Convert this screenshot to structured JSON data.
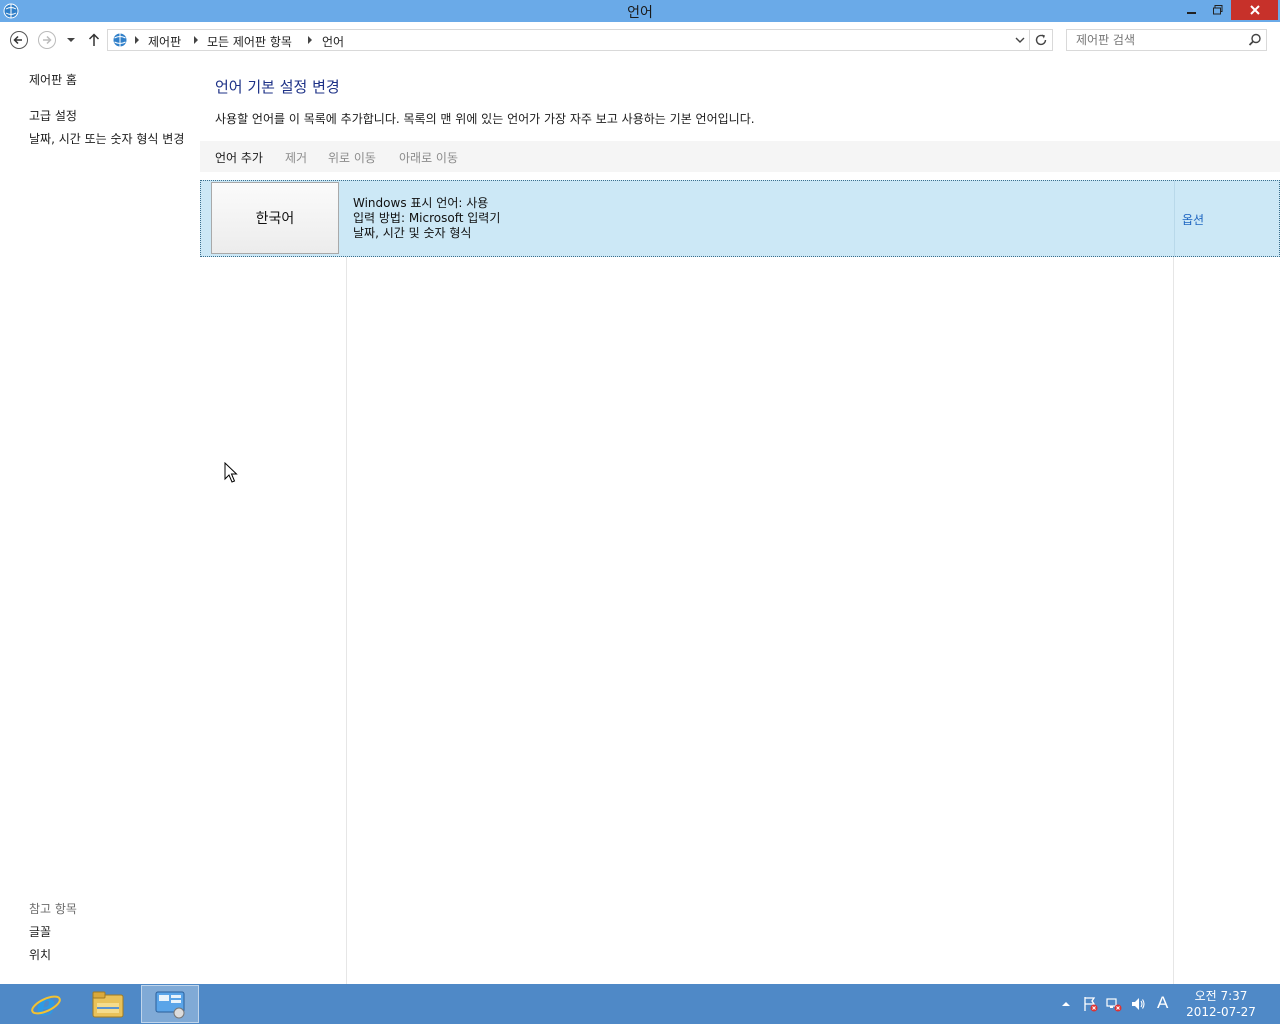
{
  "window": {
    "title": "언어",
    "icon": "control-panel-globe-icon"
  },
  "nav": {
    "breadcrumb": [
      "제어판",
      "모든 제어판 항목",
      "언어"
    ],
    "search_placeholder": "제어판 검색"
  },
  "sidebar": {
    "home": "제어판 홈",
    "links": [
      "고급 설정",
      "날짜, 시간 또는 숫자 형식 변경"
    ],
    "see_also_header": "참고 항목",
    "see_also": [
      "글꼴",
      "위치"
    ]
  },
  "main": {
    "title": "언어 기본 설정 변경",
    "description": "사용할 언어를 이 목록에 추가합니다. 목록의 맨 위에 있는 언어가 가장 자주 보고 사용하는 기본 언어입니다.",
    "toolbar": {
      "add": "언어 추가",
      "remove": "제거",
      "move_up": "위로 이동",
      "move_down": "아래로 이동"
    },
    "languages": [
      {
        "name": "한국어",
        "details": [
          "Windows 표시 언어: 사용",
          "입력 방법: Microsoft 입력기",
          "날짜, 시간 및 숫자 형식"
        ],
        "options": "옵션"
      }
    ]
  },
  "taskbar": {
    "apps": [
      "internet-explorer-icon",
      "file-explorer-icon",
      "control-panel-icon"
    ],
    "ime": "A",
    "time": "오전 7:37",
    "date": "2012-07-27"
  },
  "colors": {
    "titlebar": "#6aaae8",
    "taskbar": "#4f89c7",
    "selection": "#cce8f6",
    "link": "#1f66c1",
    "heading": "#1e3287"
  }
}
